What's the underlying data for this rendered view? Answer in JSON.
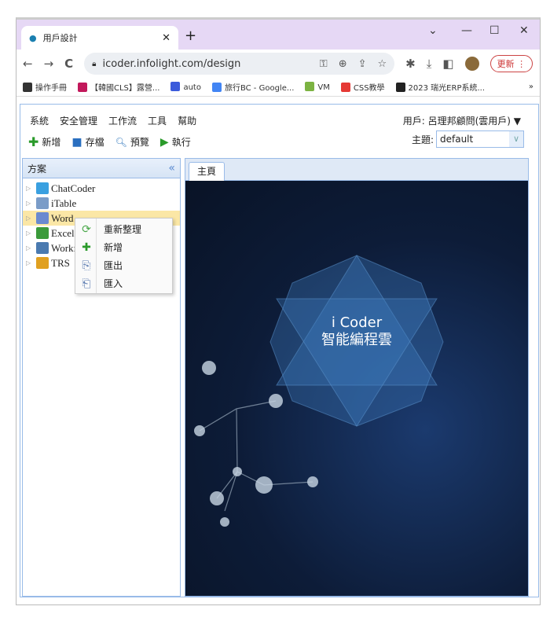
{
  "browser": {
    "tab_title": "用戶設計",
    "url": "icoder.infolight.com/design",
    "update_label": "更新",
    "bookmarks": [
      {
        "label": "操作手冊",
        "color": "#333"
      },
      {
        "label": "【韓國CLS】露營...",
        "color": "#c2185b"
      },
      {
        "label": "auto",
        "color": "#3b5bdb"
      },
      {
        "label": "旅行BC - Google...",
        "color": "#4285f4"
      },
      {
        "label": "VM",
        "color": "#7cb342"
      },
      {
        "label": "CSS教學",
        "color": "#e53935"
      },
      {
        "label": "2023 瑞光ERP系統...",
        "color": "#222"
      }
    ],
    "more_bookmarks": "»"
  },
  "app": {
    "menu": [
      "系統",
      "安全管理",
      "工作流",
      "工具",
      "幫助"
    ],
    "user": "用戶: 呂理邦顧問(雲用戶)",
    "toolbar": {
      "new": "新增",
      "save": "存檔",
      "preview": "預覽",
      "run": "執行"
    },
    "theme_label": "主題:",
    "theme_value": "default",
    "left_panel_title": "方案",
    "tree": [
      "ChatCoder",
      "iTable",
      "Word",
      "Excel",
      "Workf",
      "TRS"
    ],
    "selected_node": "Word",
    "context_menu": [
      "重新整理",
      "新增",
      "匯出",
      "匯入"
    ],
    "main_tab": "主頁",
    "hero_line1": "i Coder",
    "hero_line2": "智能編程雲"
  }
}
